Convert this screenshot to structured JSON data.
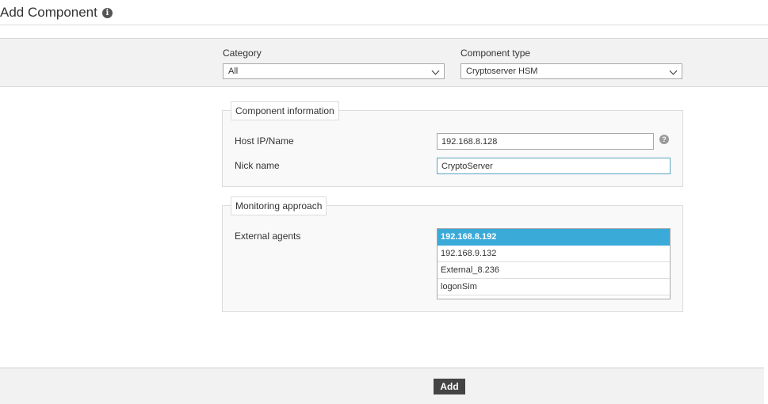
{
  "header": {
    "title": "Add Component",
    "info_icon": "i"
  },
  "filters": {
    "category": {
      "label": "Category",
      "value": "All"
    },
    "component_type": {
      "label": "Component type",
      "value": "Cryptoserver HSM"
    }
  },
  "component_info": {
    "legend": "Component information",
    "host": {
      "label": "Host IP/Name",
      "value": "192.168.8.128"
    },
    "help_icon": "?",
    "nick": {
      "label": "Nick name",
      "value": "CryptoServer"
    }
  },
  "monitoring": {
    "legend": "Monitoring approach",
    "agents_label": "External agents",
    "agents": [
      {
        "label": "192.168.8.192",
        "selected": true
      },
      {
        "label": "192.168.9.132",
        "selected": false
      },
      {
        "label": "External_8.236",
        "selected": false
      },
      {
        "label": "logonSim",
        "selected": false
      }
    ]
  },
  "footer": {
    "add_label": "Add"
  },
  "colors": {
    "selected": "#3aaad9",
    "button": "#444444",
    "band": "#f2f2f2"
  }
}
